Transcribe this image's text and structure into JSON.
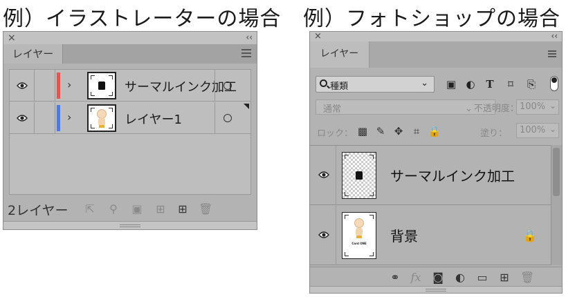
{
  "illustrator": {
    "heading": "例）イラストレーターの場合",
    "close_glyph": "×",
    "collapse_glyph": "‹‹",
    "tab_label": "レイヤー",
    "layers": [
      {
        "name": "サーマルインク加工",
        "color": "#e05555",
        "thumb": "shirt"
      },
      {
        "name": "レイヤー1",
        "color": "#5577e0",
        "thumb": "doll"
      }
    ],
    "layer_count": "2レイヤー",
    "footer_icons": [
      "export-icon",
      "search-icon",
      "clip-icon",
      "new-sublayer-icon",
      "new-layer-icon",
      "trash-icon"
    ]
  },
  "photoshop": {
    "heading": "例）フォトショップの場合",
    "close_glyph": "×",
    "collapse_glyph": "‹‹",
    "tab_label": "レイヤー",
    "filter_label": "種類",
    "blend_mode": "通常",
    "opacity_label": "不透明度：",
    "opacity_value": "100%",
    "lock_label": "ロック：",
    "fill_label": "塗り：",
    "fill_value": "100%",
    "layers": [
      {
        "name": "サーマルインク加工",
        "thumb": "shirt",
        "locked": false
      },
      {
        "name": "背景",
        "thumb": "doll",
        "locked": true
      }
    ],
    "thumb_caption": "Card ONE",
    "footer_icons": [
      "link-icon",
      "fx-icon",
      "mask-icon",
      "adjustment-icon",
      "folder-icon",
      "new-layer-icon",
      "trash-icon"
    ],
    "fx_label": "fx"
  }
}
